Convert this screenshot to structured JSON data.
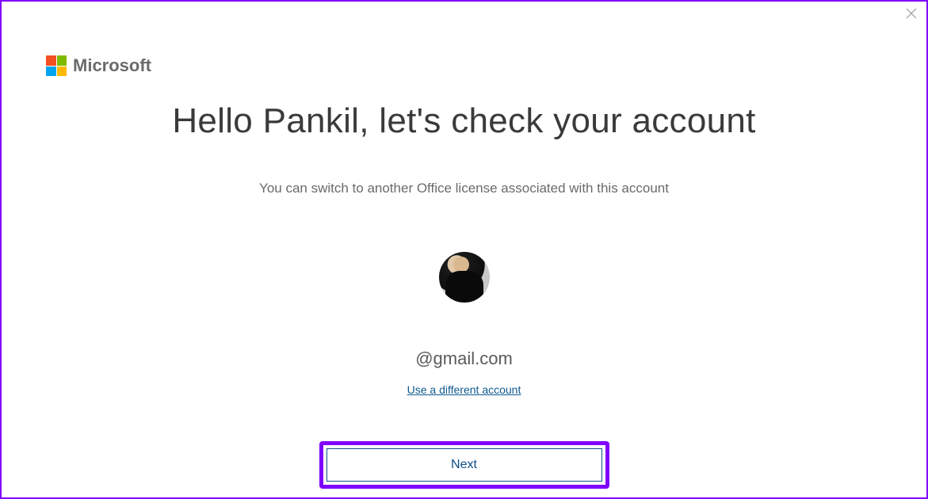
{
  "brand": {
    "text": "Microsoft"
  },
  "content": {
    "title": "Hello Pankil, let's check your account",
    "subtitle": "You can switch to another Office license associated with this account",
    "email": "@gmail.com",
    "different_account_link": "Use a different account"
  },
  "actions": {
    "next_label": "Next"
  }
}
